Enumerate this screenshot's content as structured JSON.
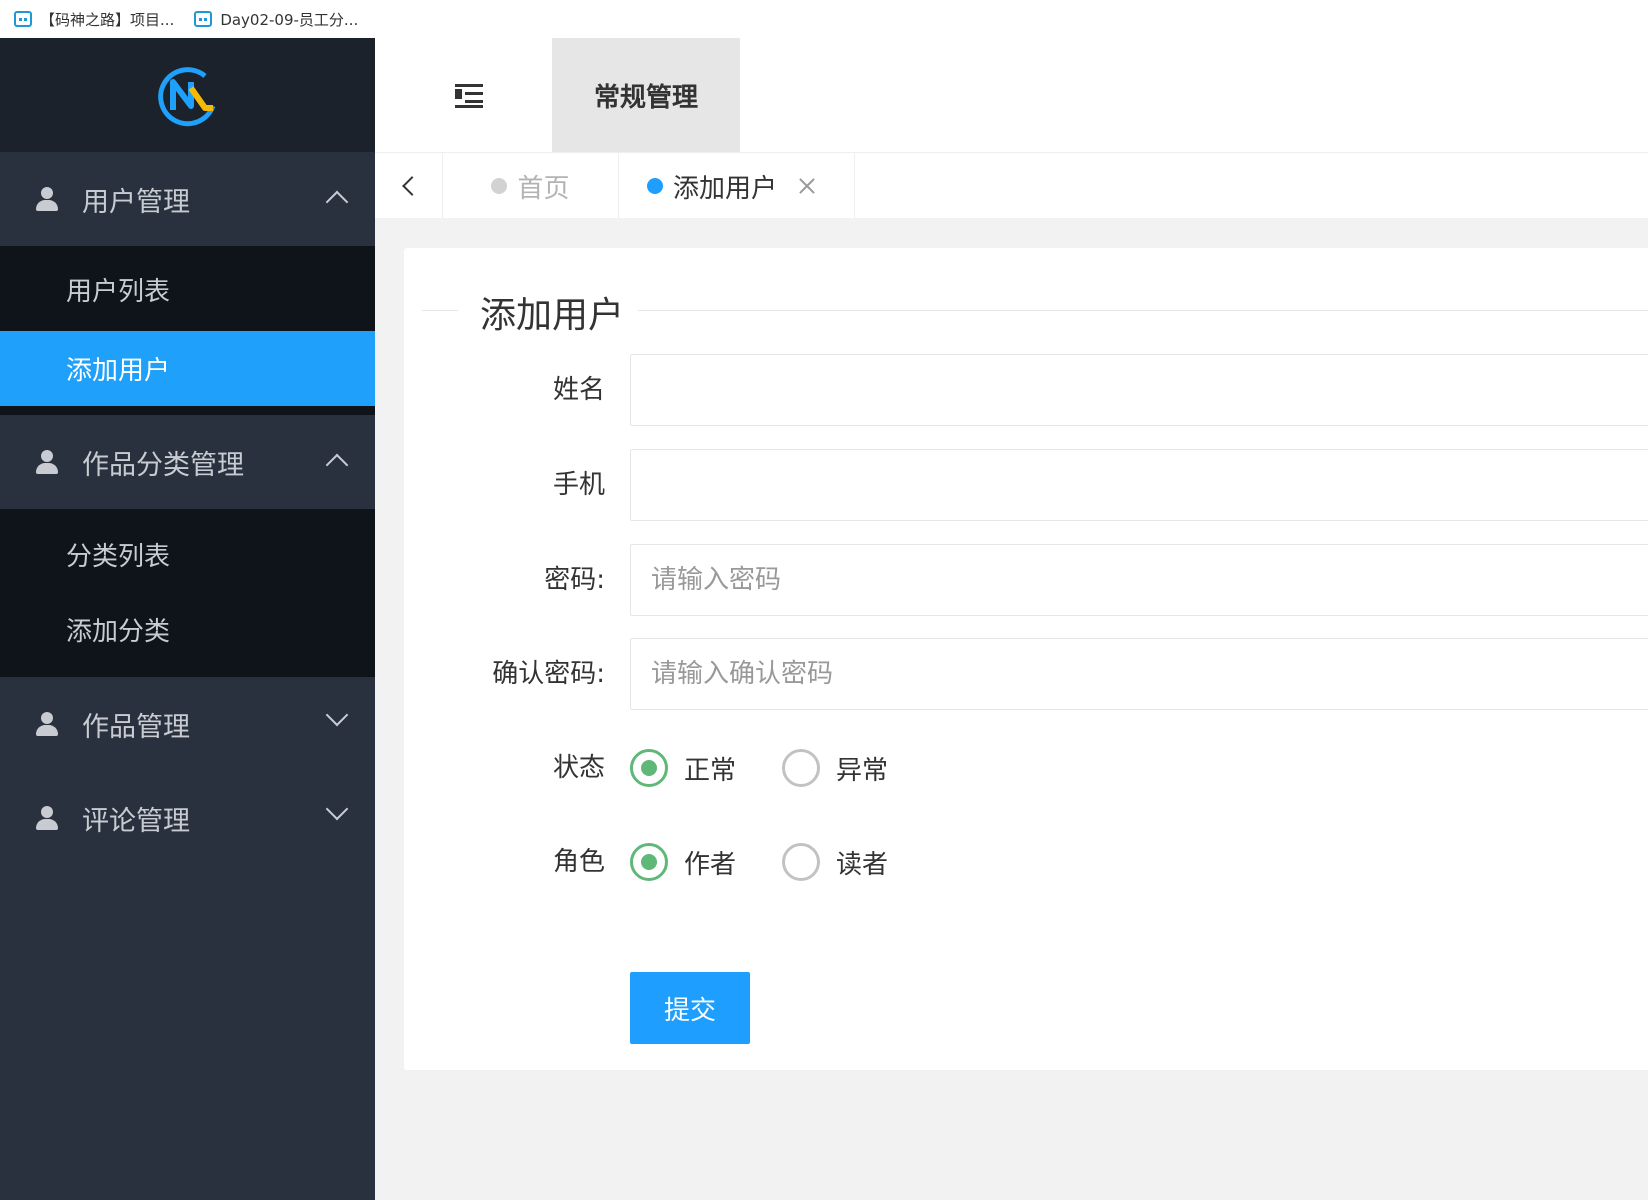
{
  "bookmarks": [
    {
      "label": "【码神之路】项目..."
    },
    {
      "label": "Day02-09-员工分..."
    }
  ],
  "sidebar": {
    "groups": [
      {
        "label": "用户管理",
        "expanded": true,
        "items": [
          {
            "label": "用户列表"
          },
          {
            "label": "添加用户",
            "active": true
          }
        ]
      },
      {
        "label": "作品分类管理",
        "expanded": true,
        "items": [
          {
            "label": "分类列表"
          },
          {
            "label": "添加分类"
          }
        ]
      },
      {
        "label": "作品管理",
        "expanded": false
      },
      {
        "label": "评论管理",
        "expanded": false
      }
    ]
  },
  "header": {
    "top_tab": "常规管理"
  },
  "tabs": {
    "home": "首页",
    "add_user": "添加用户"
  },
  "form": {
    "title": "添加用户",
    "name_label": "姓名",
    "name_value": "",
    "phone_label": "手机",
    "phone_value": "",
    "password_label": "密码:",
    "password_placeholder": "请输入密码",
    "confirm_label": "确认密码:",
    "confirm_placeholder": "请输入确认密码",
    "status_label": "状态",
    "status_options": [
      "正常",
      "异常"
    ],
    "status_selected": "正常",
    "role_label": "角色",
    "role_options": [
      "作者",
      "读者"
    ],
    "role_selected": "作者",
    "submit_label": "提交"
  },
  "colors": {
    "sidebar_bg": "#28313d",
    "accent": "#1e9fff",
    "radio_checked": "#5fb878"
  }
}
